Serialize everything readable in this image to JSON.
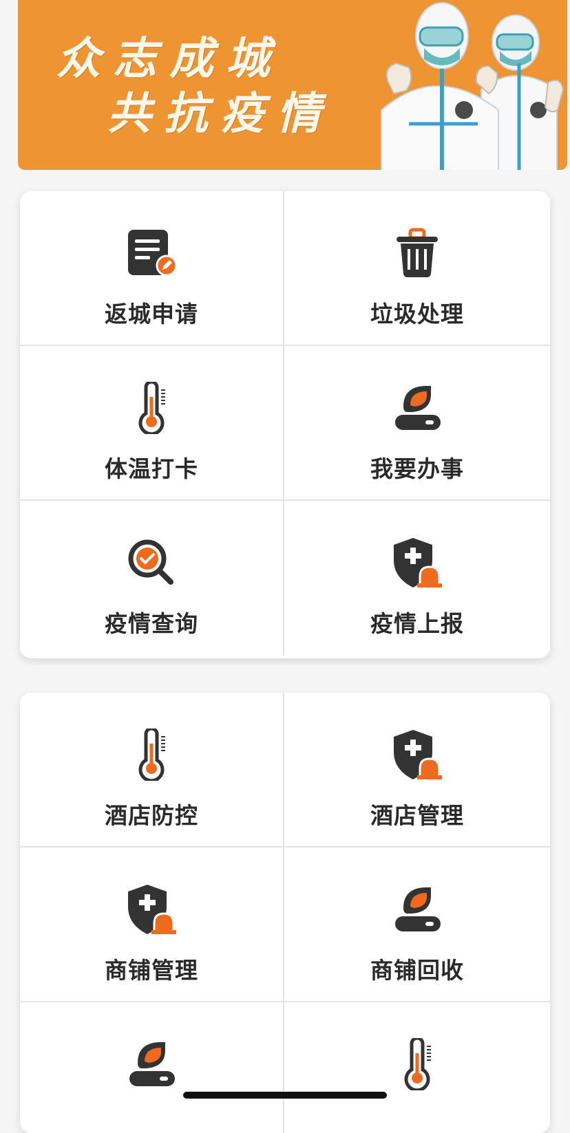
{
  "banner": {
    "line1": "众志成城",
    "line2": "共抗疫情"
  },
  "colors": {
    "banner": "#ef9432",
    "accent": "#ee6a1e",
    "icon_dark": "#333333"
  },
  "card1": [
    {
      "label": "返城申请",
      "icon": "document-edit-icon"
    },
    {
      "label": "垃圾处理",
      "icon": "trash-can-icon"
    },
    {
      "label": "体温打卡",
      "icon": "thermometer-icon"
    },
    {
      "label": "我要办事",
      "icon": "server-leaf-icon"
    },
    {
      "label": "疫情查询",
      "icon": "search-check-icon"
    },
    {
      "label": "疫情上报",
      "icon": "shield-alarm-icon"
    }
  ],
  "card2": [
    {
      "label": "酒店防控",
      "icon": "thermometer-icon"
    },
    {
      "label": "酒店管理",
      "icon": "shield-alarm-icon"
    },
    {
      "label": "商铺管理",
      "icon": "shield-alarm-icon"
    },
    {
      "label": "商铺回收",
      "icon": "server-leaf-icon"
    },
    {
      "label": "",
      "icon": "server-leaf-icon"
    },
    {
      "label": "",
      "icon": "thermometer-icon"
    }
  ]
}
